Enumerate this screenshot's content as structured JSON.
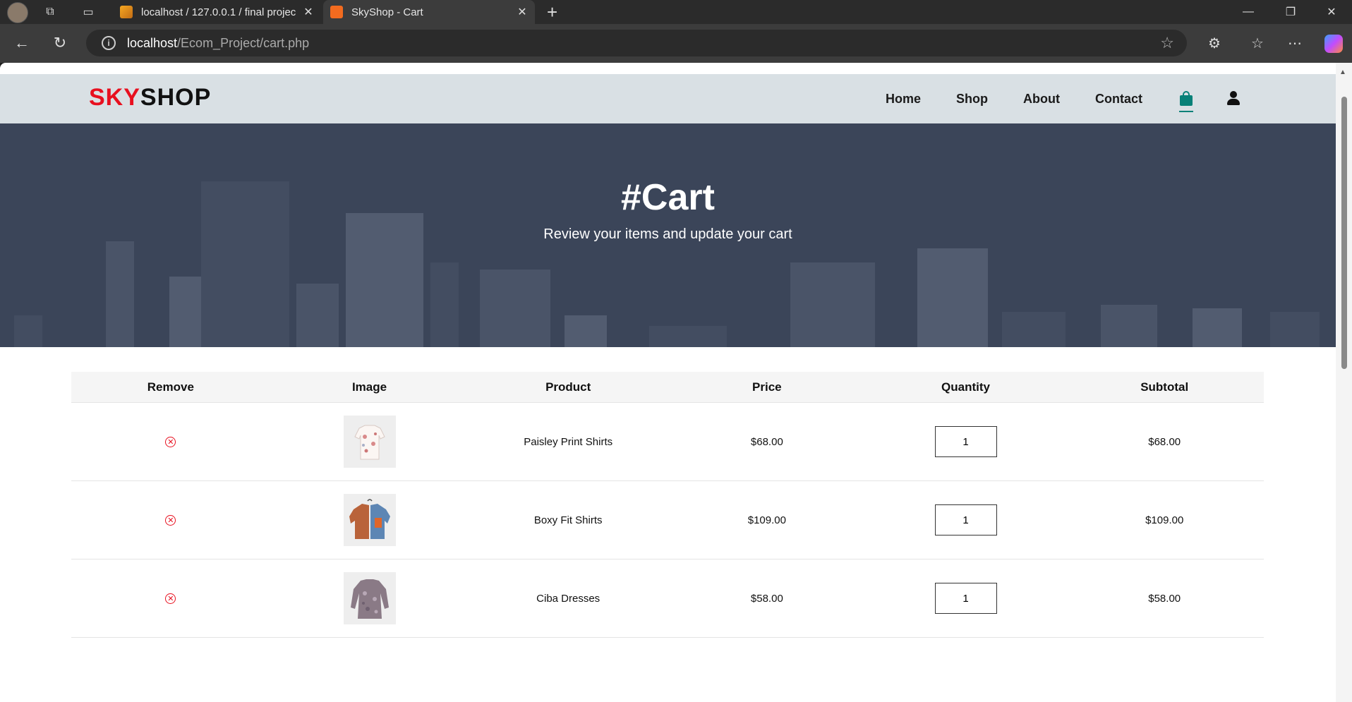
{
  "browser": {
    "tabs": [
      {
        "title": "localhost / 127.0.0.1 / final projec",
        "close": "✕"
      },
      {
        "title": "SkyShop - Cart",
        "close": "✕"
      }
    ],
    "url_host": "localhost",
    "url_path": "/Ecom_Project/cart.php"
  },
  "site": {
    "logo_part1": "SKY",
    "logo_part2": "SHOP",
    "nav": {
      "home": "Home",
      "shop": "Shop",
      "about": "About",
      "contact": "Contact"
    }
  },
  "hero": {
    "title": "#Cart",
    "subtitle": "Review your items and update your cart"
  },
  "cart": {
    "headers": {
      "remove": "Remove",
      "image": "Image",
      "product": "Product",
      "price": "Price",
      "quantity": "Quantity",
      "subtotal": "Subtotal"
    },
    "items": [
      {
        "product": "Paisley Print Shirts",
        "price": "$68.00",
        "quantity": "1",
        "subtotal": "$68.00",
        "image_icon": "paisley-shirt-image"
      },
      {
        "product": "Boxy Fit Shirts",
        "price": "$109.00",
        "quantity": "1",
        "subtotal": "$109.00",
        "image_icon": "boxy-shirt-image"
      },
      {
        "product": "Ciba Dresses",
        "price": "$58.00",
        "quantity": "1",
        "subtotal": "$58.00",
        "image_icon": "ciba-dress-image"
      }
    ]
  },
  "colors": {
    "brand_red": "#e8101f",
    "accent_teal": "#088178",
    "hero_bg": "#3b4559",
    "header_bg": "#d9e0e4"
  }
}
